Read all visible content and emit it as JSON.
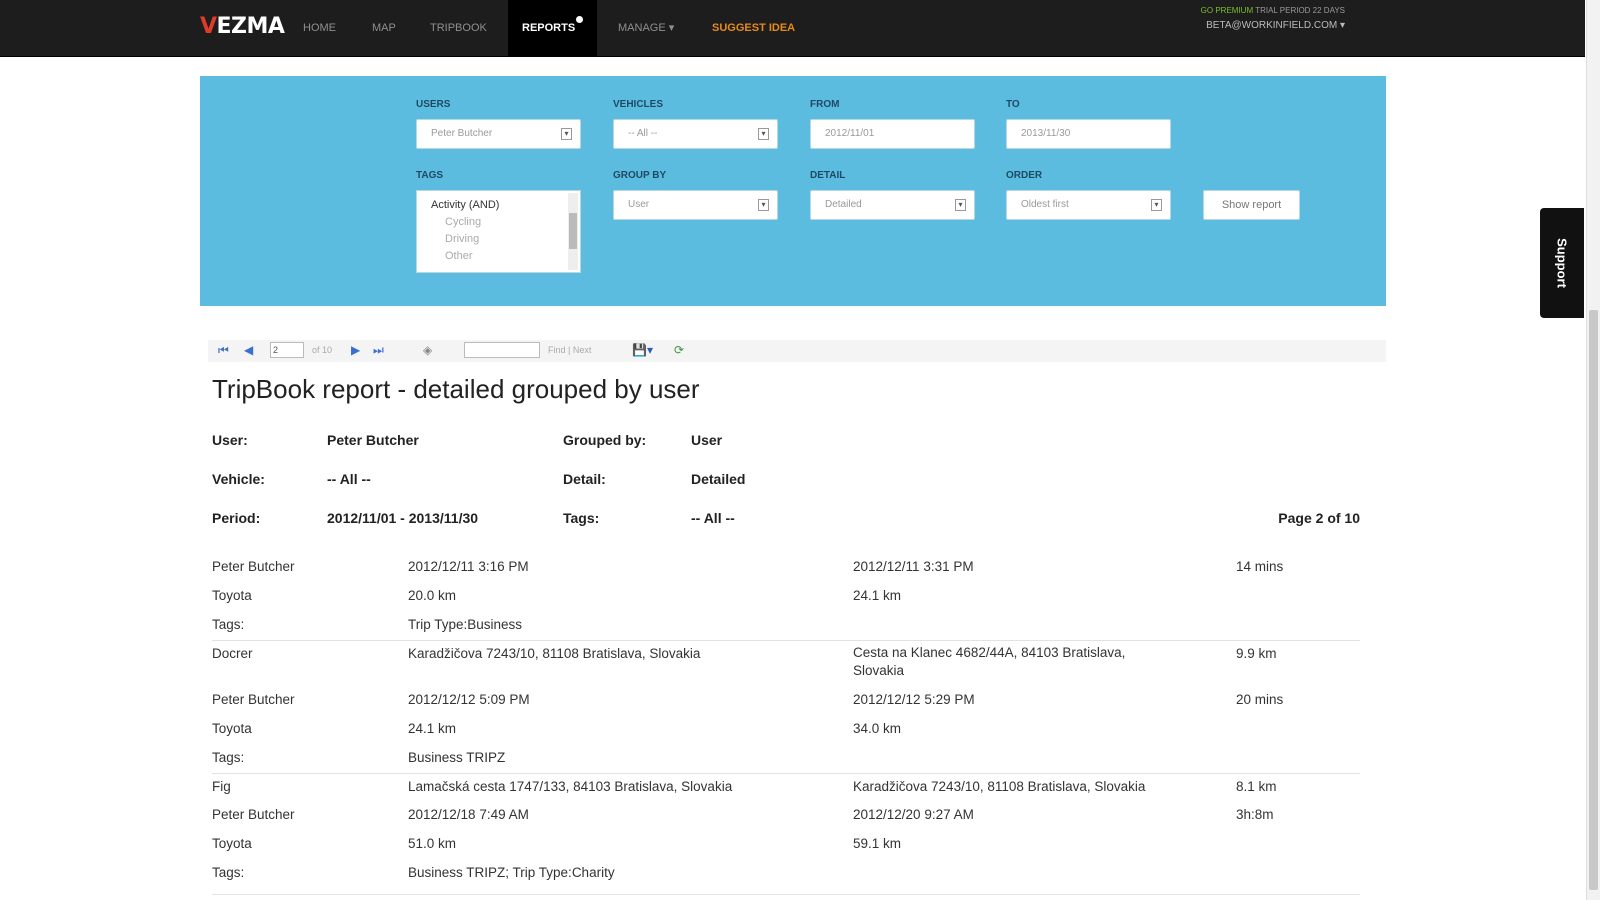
{
  "nav": {
    "logo": "VEZMA",
    "items": [
      "HOME",
      "MAP",
      "TRIPBOOK",
      "REPORTS",
      "MANAGE ▾",
      "SUGGEST IDEA"
    ],
    "trial_premium": "GO PREMIUM",
    "trial_text": "TRIAL PERIOD 22 DAYS",
    "account": "BETA@WORKINFIELD.COM ▾",
    "support": "Support"
  },
  "filters": {
    "users_label": "USERS",
    "users_value": "Peter Butcher",
    "vehicles_label": "VEHICLES",
    "vehicles_value": "-- All --",
    "from_label": "FROM",
    "from_value": "2012/11/01",
    "to_label": "TO",
    "to_value": "2013/11/30",
    "tags_label": "TAGS",
    "tags_group": "Activity (AND)",
    "tags_options": [
      "Cycling",
      "Driving",
      "Other"
    ],
    "groupby_label": "GROUP BY",
    "groupby_value": "User",
    "detail_label": "DETAIL",
    "detail_value": "Detailed",
    "order_label": "ORDER",
    "order_value": "Oldest first",
    "show_button": "Show report"
  },
  "toolbar": {
    "page_value": "2",
    "of_pages": "of 10",
    "find_next": "Find | Next"
  },
  "report": {
    "title": "TripBook report - detailed grouped by user",
    "user_label": "User:",
    "user_value": "Peter Butcher",
    "groupedby_label": "Grouped by:",
    "groupedby_value": "User",
    "vehicle_label": "Vehicle:",
    "vehicle_value": "-- All --",
    "detail_label": "Detail:",
    "detail_value": "Detailed",
    "period_label": "Period:",
    "period_value": "2012/11/01 - 2013/11/30",
    "tags_label": "Tags:",
    "tags_value": "-- All --",
    "page_info": "Page 2 of 10",
    "rows": [
      [
        "Peter Butcher",
        "2012/12/11 3:16 PM",
        "2012/12/11 3:31 PM",
        "14 mins"
      ],
      [
        "Toyota",
        "20.0 km",
        "24.1 km",
        ""
      ],
      [
        "Tags:",
        "Trip Type:Business",
        "",
        ""
      ],
      [
        "Docrer",
        "Karadžičova 7243/10, 81108 Bratislava, Slovakia",
        "Cesta na Klanec 4682/44A, 84103 Bratislava,\nSlovakia",
        "9.9 km"
      ],
      [
        "Peter Butcher",
        "2012/12/12 5:09 PM",
        "2012/12/12 5:29 PM",
        "20 mins"
      ],
      [
        "Toyota",
        "24.1 km",
        "34.0 km",
        ""
      ],
      [
        "Tags:",
        "Business TRIPZ",
        "",
        ""
      ],
      [
        "Fig",
        "Lamačská cesta 1747/133, 84103 Bratislava, Slovakia",
        "Karadžičova 7243/10, 81108 Bratislava, Slovakia",
        "8.1 km"
      ],
      [
        "Peter Butcher",
        "2012/12/18 7:49 AM",
        "2012/12/20 9:27 AM",
        "3h:8m"
      ],
      [
        "Toyota",
        "51.0 km",
        "59.1 km",
        ""
      ],
      [
        "Tags:",
        "Business TRIPZ; Trip Type:Charity",
        "",
        ""
      ]
    ]
  }
}
